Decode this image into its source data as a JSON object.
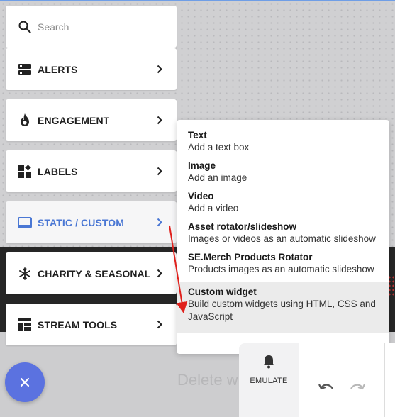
{
  "search": {
    "placeholder": "Search"
  },
  "menu": {
    "items": [
      {
        "label": "ALERTS",
        "icon": "alerts-icon"
      },
      {
        "label": "ENGAGEMENT",
        "icon": "flame-icon"
      },
      {
        "label": "LABELS",
        "icon": "labels-icon"
      },
      {
        "label": "STATIC / CUSTOM",
        "icon": "static-custom-icon",
        "active": true
      },
      {
        "label": "CHARITY & SEASONAL",
        "icon": "snowflake-icon"
      },
      {
        "label": "STREAM TOOLS",
        "icon": "stream-tools-icon"
      }
    ]
  },
  "submenu": {
    "options": [
      {
        "title": "Text",
        "desc": "Add a text box"
      },
      {
        "title": "Image",
        "desc": "Add an image"
      },
      {
        "title": "Video",
        "desc": "Add a video"
      },
      {
        "title": "Asset rotator/slideshow",
        "desc": "Images or videos as an automatic slideshow"
      },
      {
        "title": "SE.Merch Products Rotator",
        "desc": "Products images as an automatic slideshow"
      },
      {
        "title": "Custom widget",
        "desc": "Build custom widgets using HTML, CSS and JavaScript",
        "highlighted": true
      }
    ]
  },
  "footer": {
    "close_icon": "close-icon",
    "delete_text": "Delete w",
    "emulate_label": "EMULATE",
    "undo_icon": "undo-icon",
    "redo_icon": "redo-icon"
  },
  "colors": {
    "accent": "#4a77d4",
    "fab": "#5b72e0",
    "annotation_arrow": "#e0201c"
  }
}
